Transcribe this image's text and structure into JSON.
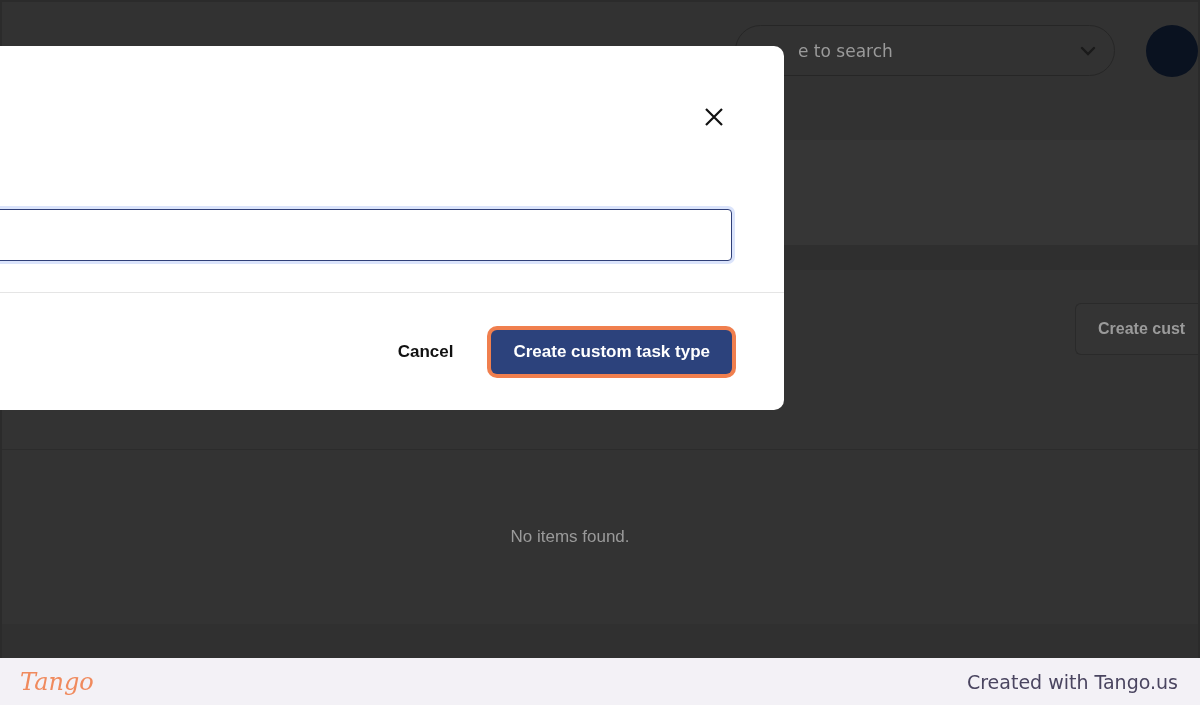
{
  "app": {
    "search": {
      "placeholder": "e to search"
    },
    "create_button": {
      "label": "Create cust"
    },
    "empty_message": "No items found."
  },
  "dialog": {
    "buttons": [
      {
        "label": "Cancel",
        "kind": "secondary",
        "highlighted": false
      },
      {
        "label": "Create custom task type",
        "kind": "primary",
        "highlighted": true
      }
    ]
  },
  "footer": {
    "logo": "Tango",
    "credit": "Created with Tango.us"
  }
}
